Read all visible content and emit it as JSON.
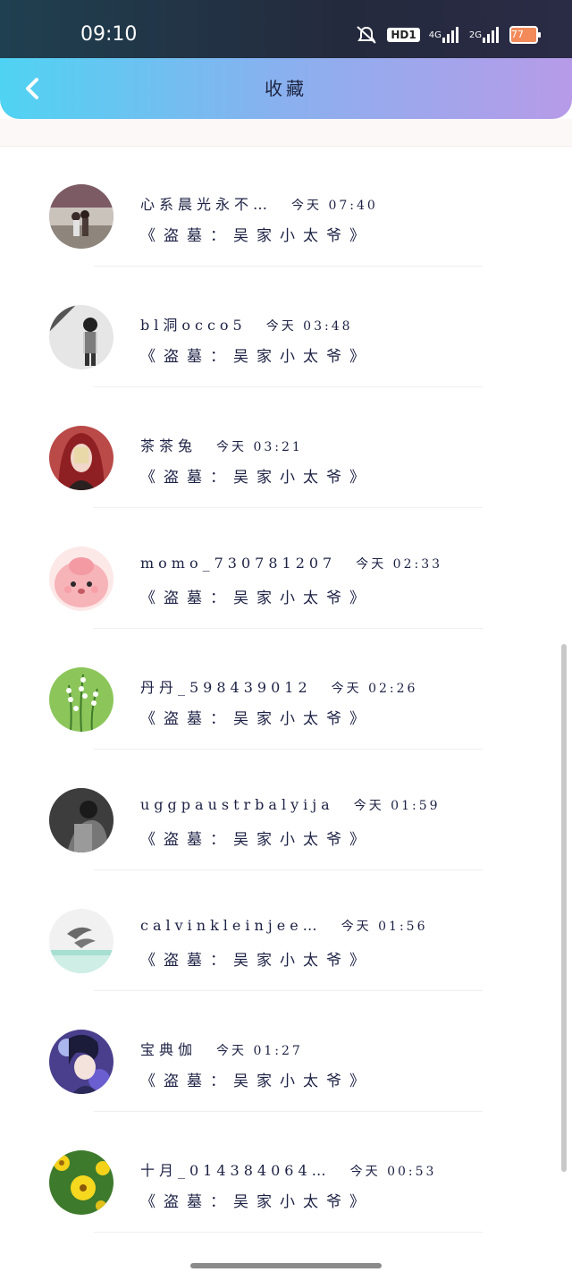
{
  "status_bar": {
    "time": "09:10",
    "hd": "HD1",
    "network1": "4G",
    "network2": "2G",
    "battery": "77"
  },
  "header": {
    "title": "收藏"
  },
  "items": [
    {
      "name": "心系晨光永不…",
      "time": "今天 07:40",
      "text": "《盗墓：吴家小太爷》",
      "avatar": "photo-couple"
    },
    {
      "name": "bl洞occo5",
      "time": "今天 03:48",
      "text": "《盗墓：吴家小太爷》",
      "avatar": "photo-bw-person"
    },
    {
      "name": "茶茶兔",
      "time": "今天 03:21",
      "text": "《盗墓：吴家小太爷》",
      "avatar": "photo-red-hood"
    },
    {
      "name": "momo_730781207",
      "time": "今天 02:33",
      "text": "《盗墓：吴家小太爷》",
      "avatar": "cartoon-pink"
    },
    {
      "name": "丹丹_598439012",
      "time": "今天 02:26",
      "text": "《盗墓：吴家小太爷》",
      "avatar": "flowers-green"
    },
    {
      "name": "uggpaustrbalyija",
      "time": "今天 01:59",
      "text": "《盗墓：吴家小太爷》",
      "avatar": "photo-dark"
    },
    {
      "name": "calvinkleinjee…",
      "time": "今天 01:56",
      "text": "《盗墓：吴家小太爷》",
      "avatar": "dolphins"
    },
    {
      "name": "宝典伽",
      "time": "今天 01:27",
      "text": "《盗墓：吴家小太爷》",
      "avatar": "anime-boy"
    },
    {
      "name": "十月_014384064…",
      "time": "今天 00:53",
      "text": "《盗墓：吴家小太爷》",
      "avatar": "yellow-flowers"
    }
  ],
  "colors": {
    "header_start": "#4fd3f3",
    "header_end": "#b79be8",
    "text": "#1d2245"
  }
}
